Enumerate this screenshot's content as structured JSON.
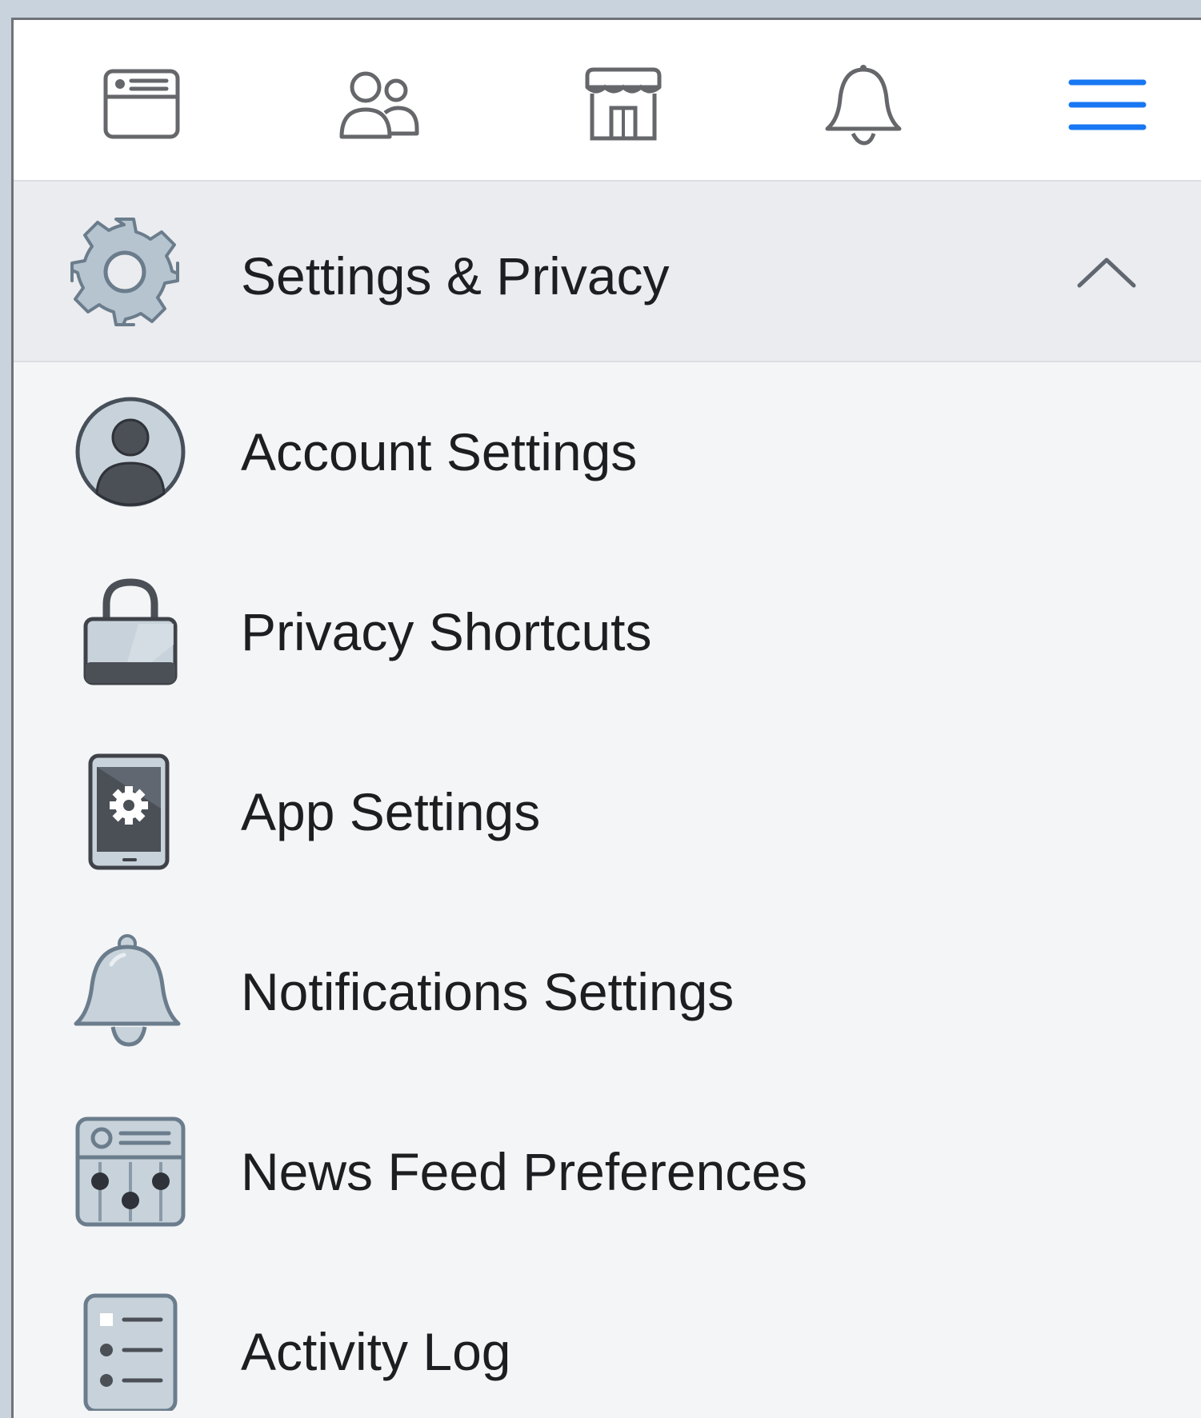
{
  "top_nav": {
    "icons": [
      "news-feed-icon",
      "friends-icon",
      "marketplace-icon",
      "notifications-icon",
      "menu-icon"
    ],
    "active": "menu-icon",
    "active_color": "#1877f2",
    "icon_color": "#65676b"
  },
  "section": {
    "title": "Settings & Privacy",
    "icon": "gear-icon",
    "expanded": true
  },
  "menu": {
    "items": [
      {
        "label": "Account Settings",
        "icon": "account-icon"
      },
      {
        "label": "Privacy Shortcuts",
        "icon": "lock-icon"
      },
      {
        "label": "App Settings",
        "icon": "phone-gear-icon"
      },
      {
        "label": "Notifications Settings",
        "icon": "bell-icon"
      },
      {
        "label": "News Feed Preferences",
        "icon": "news-feed-preferences-icon"
      },
      {
        "label": "Activity Log",
        "icon": "activity-log-icon"
      }
    ]
  }
}
